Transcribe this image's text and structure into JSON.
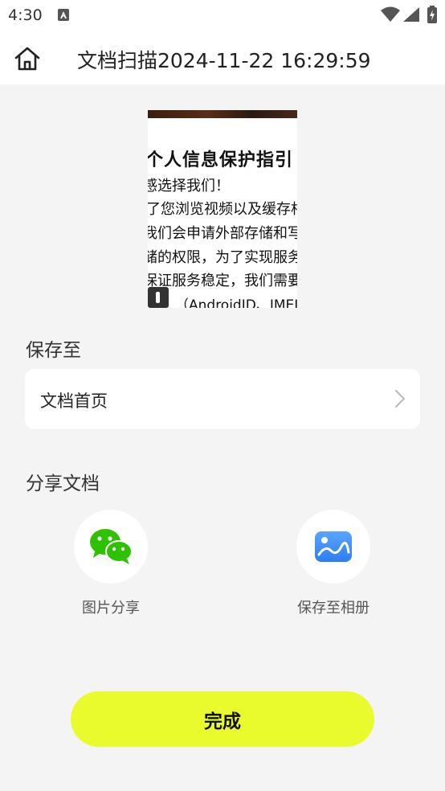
{
  "status_bar": {
    "time": "4:30"
  },
  "header": {
    "title": "文档扫描2024-11-22 16:29:59",
    "home_icon": "home-icon"
  },
  "preview": {
    "heading": "个人信息保护指引",
    "lines": [
      "感选择我们！",
      "了您浏览视频以及缓存相",
      "我们会申请外部存储和写",
      "储的权限，为了实现服务",
      "保证服务稳定，我们需要",
      "（AndroidID、IMEI、"
    ]
  },
  "save_section": {
    "label": "保存至",
    "destination": "文档首页"
  },
  "share_section": {
    "label": "分享文档",
    "options": [
      {
        "label": "图片分享",
        "icon": "wechat-icon"
      },
      {
        "label": "保存至相册",
        "icon": "gallery-icon"
      }
    ]
  },
  "done_button": {
    "label": "完成"
  },
  "colors": {
    "accent": "#eafb2d",
    "wechat_green": "#2dc100",
    "gallery_blue": "#3f8ef7",
    "background": "#f4f4f4"
  }
}
